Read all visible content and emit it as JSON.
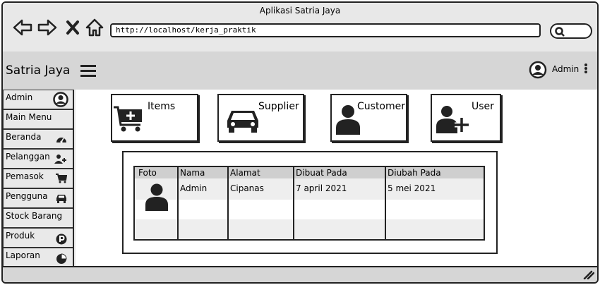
{
  "window": {
    "title": "Aplikasi Satria Jaya"
  },
  "browser": {
    "url": "http://localhost/kerja_praktik",
    "back_icon": "back-arrow-icon",
    "forward_icon": "forward-arrow-icon",
    "close_icon": "close-icon",
    "home_icon": "home-icon",
    "search_icon": "search-icon"
  },
  "appbar": {
    "brand": "Satria Jaya",
    "user_name": "Admin"
  },
  "sidebar": {
    "items": [
      {
        "label": "Admin",
        "icon": "user-avatar-icon"
      },
      {
        "label": "Main Menu",
        "icon": ""
      },
      {
        "label": "Beranda",
        "icon": "dashboard-icon"
      },
      {
        "label": "Pelanggan",
        "icon": "user-plus-icon"
      },
      {
        "label": "Pemasok",
        "icon": "cart-icon"
      },
      {
        "label": "Pengguna",
        "icon": "car-icon"
      },
      {
        "label": "Stock Barang",
        "icon": ""
      },
      {
        "label": "Produk",
        "icon": "p-badge-icon"
      },
      {
        "label": "Laporan",
        "icon": "pie-chart-icon"
      }
    ]
  },
  "cards": [
    {
      "label": "Items",
      "icon": "cart-plus-icon"
    },
    {
      "label": "Supplier",
      "icon": "car-icon"
    },
    {
      "label": "Customer",
      "icon": "user-icon"
    },
    {
      "label": "User",
      "icon": "user-plus-icon"
    }
  ],
  "table": {
    "columns": [
      "Foto",
      "Nama",
      "Alamat",
      "Dibuat Pada",
      "Diubah Pada"
    ],
    "rows": [
      {
        "foto": "user-icon",
        "nama": "Admin",
        "alamat": "Cipanas",
        "dibuat": "7 april 2021",
        "diubah": "5 mei 2021"
      }
    ]
  }
}
